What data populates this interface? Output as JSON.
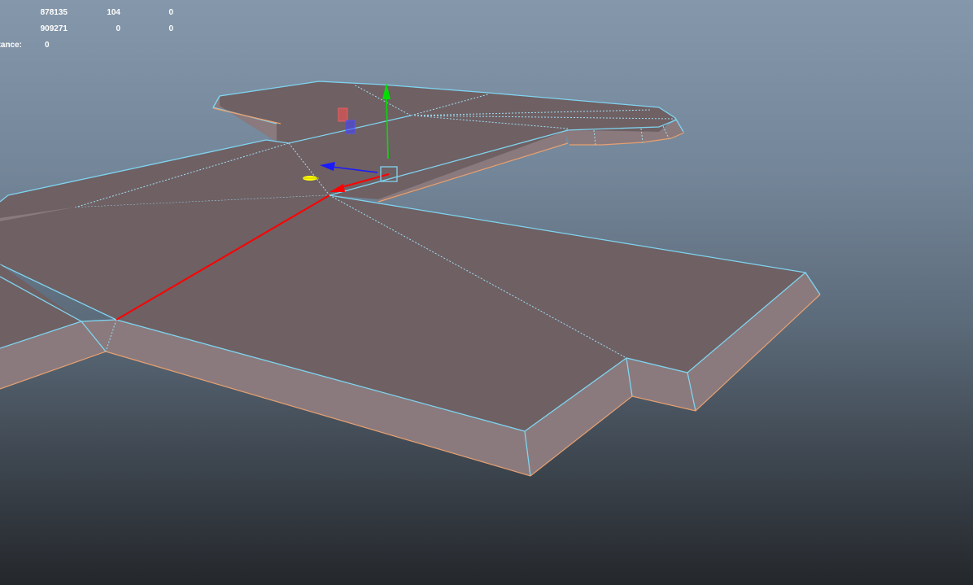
{
  "hud": {
    "rows": [
      [
        "878135",
        "104",
        "0"
      ],
      [
        "909271",
        "0",
        "0"
      ]
    ],
    "distance_label": "stance:",
    "distance_value": "0"
  },
  "colors": {
    "mesh_top": "#6f6063",
    "mesh_side": "#8a7a7d",
    "selected_edge": "#7fd4f0",
    "boundary_edge": "#e8a070",
    "axis_x": "#ff0000",
    "axis_y": "#00e000",
    "axis_z": "#1a1aff",
    "pivot": "#ffff00"
  },
  "icons": {
    "manipulator": "move-tool-manipulator-icon",
    "pivot": "pivot-handle-icon"
  }
}
